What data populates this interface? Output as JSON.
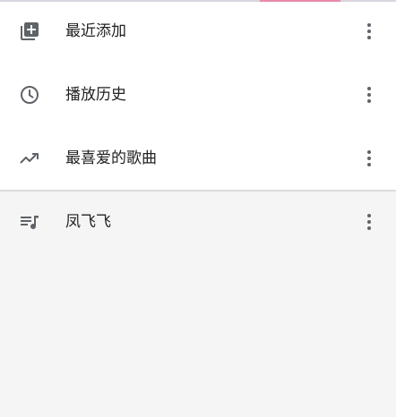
{
  "playlists": [
    {
      "label": "最近添加",
      "icon": "playlist-add-icon"
    },
    {
      "label": "播放历史",
      "icon": "history-clock-icon"
    },
    {
      "label": "最喜爱的歌曲",
      "icon": "trending-up-icon"
    }
  ],
  "user_playlists": [
    {
      "label": "凤飞飞",
      "icon": "queue-music-icon"
    }
  ],
  "colors": {
    "icon": "#5f6368",
    "text": "#222222",
    "background": "#f5f5f5",
    "card": "#ffffff"
  }
}
